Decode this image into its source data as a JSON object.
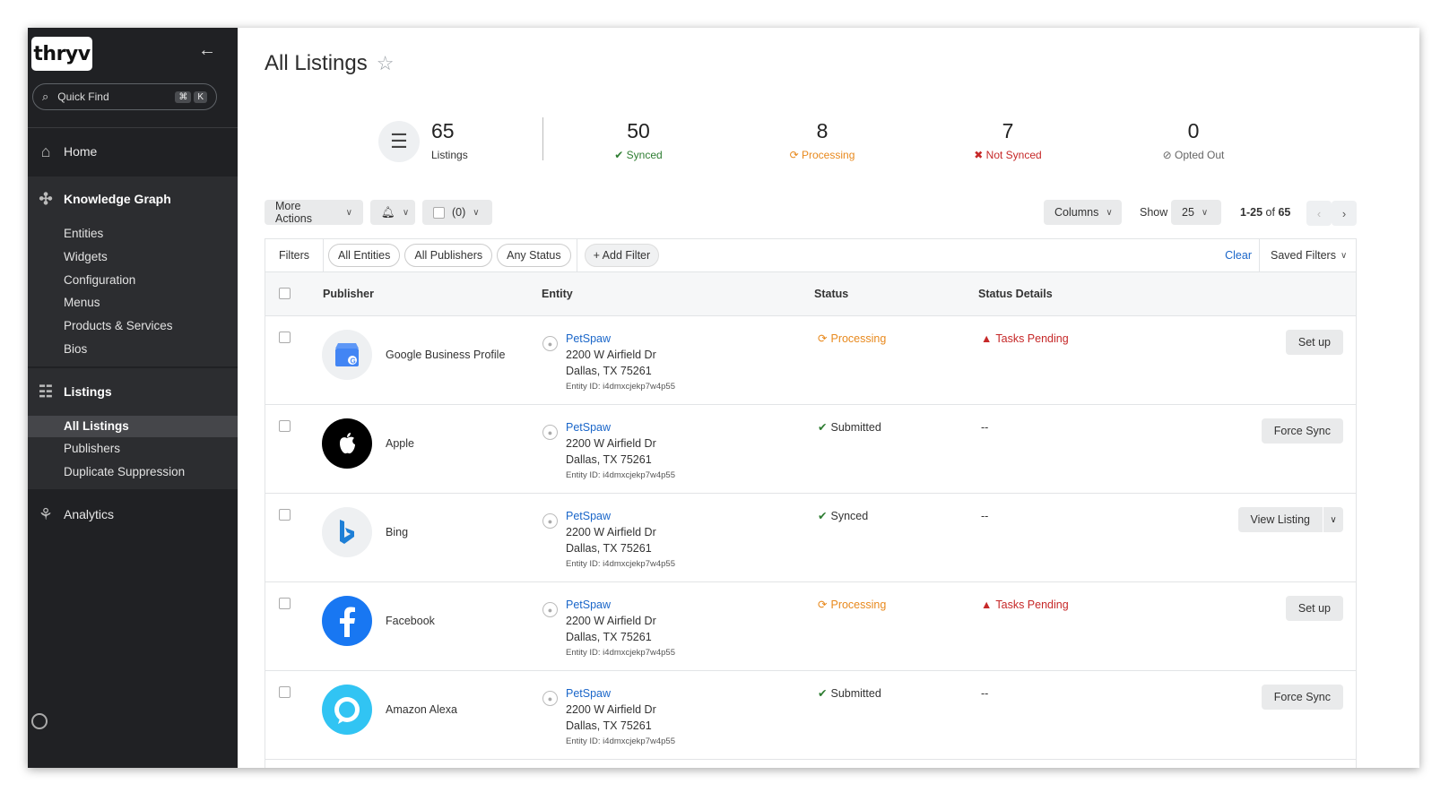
{
  "app": {
    "logo_text": "thryv",
    "collapse_icon": "arrow-left-icon"
  },
  "search": {
    "placeholder": "Quick Find",
    "key1": "⌘",
    "key2": "K"
  },
  "sidebar": {
    "home": "Home",
    "knowledge_graph": "Knowledge Graph",
    "kg_items": [
      "Entities",
      "Widgets",
      "Configuration",
      "Menus",
      "Products & Services",
      "Bios"
    ],
    "listings": "Listings",
    "listing_items": [
      "All Listings",
      "Publishers",
      "Duplicate Suppression"
    ],
    "analytics": "Analytics"
  },
  "page": {
    "title": "All Listings"
  },
  "stats": {
    "listings": {
      "value": "65",
      "label": "Listings"
    },
    "synced": {
      "value": "50",
      "label": "Synced",
      "color": "#2e7d32"
    },
    "processing": {
      "value": "8",
      "label": "Processing",
      "color": "#e8891d"
    },
    "not_synced": {
      "value": "7",
      "label": "Not Synced",
      "color": "#c62828"
    },
    "opted_out": {
      "value": "0",
      "label": "Opted Out",
      "color": "#666666"
    }
  },
  "toolbar": {
    "more_actions": "More Actions",
    "selected_count": "(0)",
    "columns": "Columns",
    "show_label": "Show",
    "page_size": "25",
    "range": "1-25",
    "of": "of",
    "total": "65"
  },
  "filters": {
    "label": "Filters",
    "chips": [
      "All Entities",
      "All Publishers",
      "Any Status"
    ],
    "add": "+ Add Filter",
    "clear": "Clear",
    "saved": "Saved Filters"
  },
  "table": {
    "headers": {
      "publisher": "Publisher",
      "entity": "Entity",
      "status": "Status",
      "details": "Status Details"
    },
    "rows": [
      {
        "publisher": "Google Business Profile",
        "entity_name": "PetSpaw",
        "addr1": "2200 W Airfield Dr",
        "addr2": "Dallas, TX 75261",
        "entity_id": "Entity ID: i4dmxcjekp7w4p55",
        "status": "Processing",
        "details": "Tasks Pending",
        "action": "Set up"
      },
      {
        "publisher": "Apple",
        "entity_name": "PetSpaw",
        "addr1": "2200 W Airfield Dr",
        "addr2": "Dallas, TX 75261",
        "entity_id": "Entity ID: i4dmxcjekp7w4p55",
        "status": "Submitted",
        "details": "--",
        "action": "Force Sync"
      },
      {
        "publisher": "Bing",
        "entity_name": "PetSpaw",
        "addr1": "2200 W Airfield Dr",
        "addr2": "Dallas, TX 75261",
        "entity_id": "Entity ID: i4dmxcjekp7w4p55",
        "status": "Synced",
        "details": "--",
        "action": "View Listing"
      },
      {
        "publisher": "Facebook",
        "entity_name": "PetSpaw",
        "addr1": "2200 W Airfield Dr",
        "addr2": "Dallas, TX 75261",
        "entity_id": "Entity ID: i4dmxcjekp7w4p55",
        "status": "Processing",
        "details": "Tasks Pending",
        "action": "Set up"
      },
      {
        "publisher": "Amazon Alexa",
        "entity_name": "PetSpaw",
        "addr1": "2200 W Airfield Dr",
        "addr2": "Dallas, TX 75261",
        "entity_id": "Entity ID: i4dmxcjekp7w4p55",
        "status": "Submitted",
        "details": "--",
        "action": "Force Sync"
      }
    ]
  },
  "colors": {
    "link": "#1a66c9",
    "ok": "#2e7d32",
    "warn": "#e8891d",
    "error": "#c62828",
    "sidebar_bg": "#202124"
  }
}
